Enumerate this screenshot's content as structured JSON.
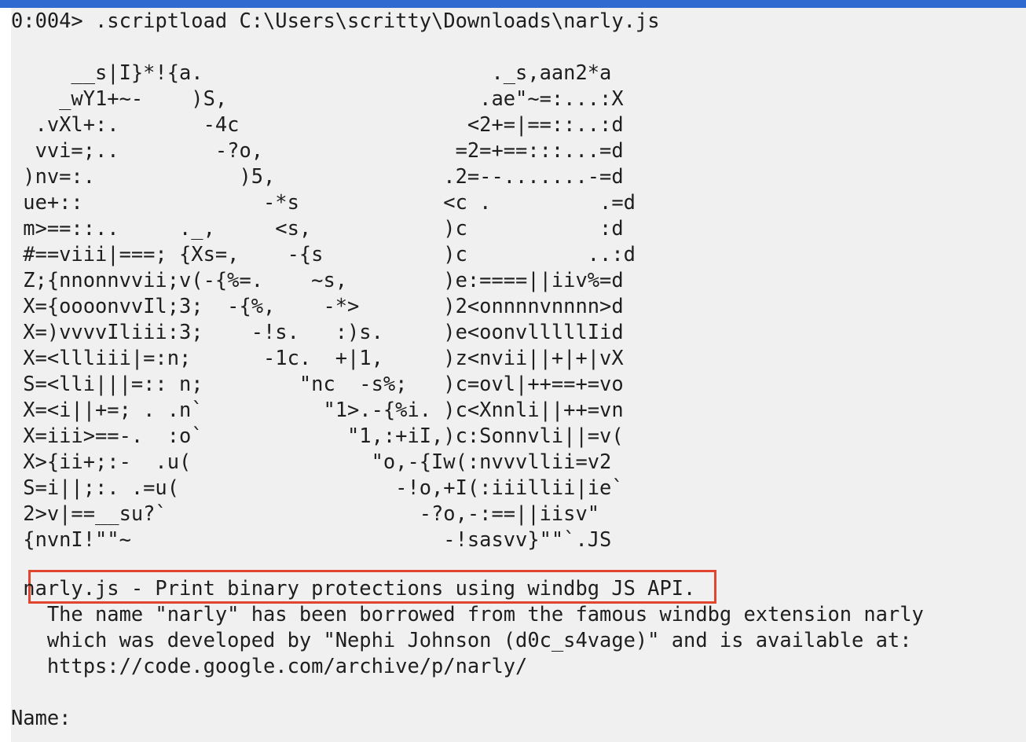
{
  "colors": {
    "topbar": "#2f6ad0",
    "console_background": "#f0f0f0",
    "text": "#1e1e1e",
    "highlight_border": "#e0452f"
  },
  "command": {
    "prompt": "0:004>",
    "text": ".scriptload C:\\Users\\scritty\\Downloads\\narly.js"
  },
  "ascii_art": [
    "     __s|I}*!{a.                        ._s,aan2*a",
    "    _wY1+~-    )S,                     .ae\"~=:...:X",
    "  .vXl+:.       -4c                   <2+=|==::..:d",
    "  vvi=;..        -?o,                =2=+==:::...=d",
    " )nv=:.            )5,              .2=--.......-=d",
    " ue+::               -*s            <c .         .=d",
    " m>==::..     ._,     <s,           )c           :d",
    " #==viii|===; {Xs=,    -{s          )c          ..:d",
    " Z;{nnonnvvii;v(-{%=.    ~s,        )e:====||iiv%=d",
    " X={oooonvvIl;3;  -{%,    -*>       )2<onnnnvnnnn>d",
    " X=)vvvvIliii:3;    -!s.   :)s.     )e<oonvlllllIid",
    " X=<llliii|=:n;      -1c.  +|1,     )z<nvii||+|+|vX",
    " S=<lli|||=:: n;        \"nc  -s%;   )c=ovl|++==+=vo",
    " X=<i||+=; . .n`          \"1>.-{%i. )c<Xnnli||++=vn",
    " X=iii>==-.  :o`            \"1,:+iI,)c:Sonnvli||=v(",
    " X>{ii+;:-  .u(               \"o,-{Iw(:nvvvllii=v2",
    " S=i||;:. .=u(                  -!o,+I(:iiillii|ie`",
    " 2>v|==__su?`                     -?o,-:==||iisv\"",
    " {nvnI!\"\"~                          -!sasvv}\"\"`.JS"
  ],
  "description": {
    "title": " narly.js - Print binary protections using windbg JS API.",
    "lines": [
      "   The name \"narly\" has been borrowed from the famous windbg extension narly",
      "   which was developed by \"Nephi Johnson (d0c_s4vage)\" and is available at:",
      "   https://code.google.com/archive/p/narly/"
    ]
  },
  "name_label": "Name:"
}
